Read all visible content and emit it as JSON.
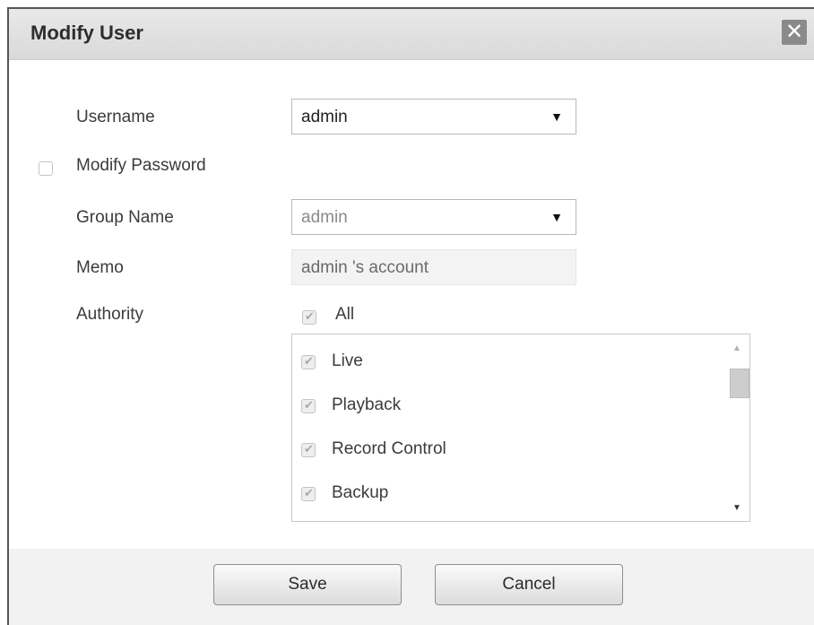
{
  "dialog": {
    "title": "Modify User",
    "close_icon": "close-icon"
  },
  "form": {
    "username_label": "Username",
    "username_value": "admin",
    "modify_password_label": "Modify Password",
    "modify_password_checked": false,
    "group_name_label": "Group Name",
    "group_name_value": "admin",
    "memo_label": "Memo",
    "memo_value": "admin 's account",
    "authority_label": "Authority",
    "authority_all_label": "All",
    "authority_all_checked": true
  },
  "authority_list": {
    "items": [
      {
        "label": "Live",
        "checked": true
      },
      {
        "label": "Playback",
        "checked": true
      },
      {
        "label": "Record Control",
        "checked": true
      },
      {
        "label": "Backup",
        "checked": true
      }
    ]
  },
  "footer": {
    "save_label": "Save",
    "cancel_label": "Cancel"
  }
}
